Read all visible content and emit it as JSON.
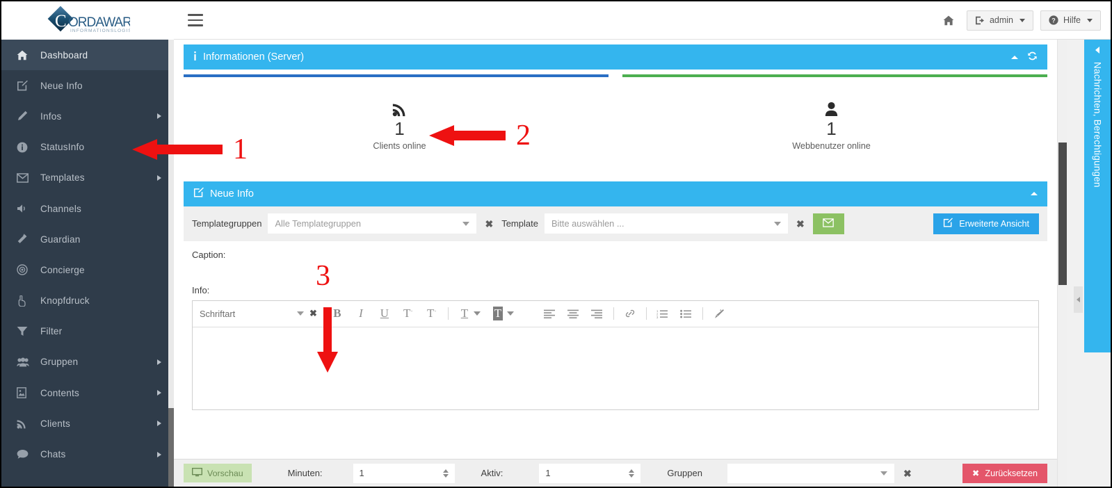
{
  "brand": {
    "name": "CORDAWARE",
    "tagline": "INFORMATIONSLOGISTIK"
  },
  "topbar": {
    "menu_toggle": "hamburger-icon",
    "home_icon": "home-icon",
    "user_button": "admin",
    "help_button": "Hilfe"
  },
  "sidebar": {
    "items": [
      {
        "label": "Dashboard",
        "icon": "home-icon",
        "active": true,
        "submenu": false
      },
      {
        "label": "Neue Info",
        "icon": "edit-square-icon",
        "active": false,
        "submenu": false
      },
      {
        "label": "Infos",
        "icon": "pencil-icon",
        "active": false,
        "submenu": true
      },
      {
        "label": "StatusInfo",
        "icon": "info-circle-icon",
        "active": false,
        "submenu": false
      },
      {
        "label": "Templates",
        "icon": "envelope-icon",
        "active": false,
        "submenu": true
      },
      {
        "label": "Channels",
        "icon": "speaker-icon",
        "active": false,
        "submenu": false
      },
      {
        "label": "Guardian",
        "icon": "magic-wand-icon",
        "active": false,
        "submenu": false
      },
      {
        "label": "Concierge",
        "icon": "bullseye-icon",
        "active": false,
        "submenu": false
      },
      {
        "label": "Knopfdruck",
        "icon": "hand-pointer-icon",
        "active": false,
        "submenu": false
      },
      {
        "label": "Filter",
        "icon": "funnel-icon",
        "active": false,
        "submenu": false
      },
      {
        "label": "Gruppen",
        "icon": "users-icon",
        "active": false,
        "submenu": true
      },
      {
        "label": "Contents",
        "icon": "image-file-icon",
        "active": false,
        "submenu": true
      },
      {
        "label": "Clients",
        "icon": "rss-icon",
        "active": false,
        "submenu": true
      },
      {
        "label": "Chats",
        "icon": "comment-icon",
        "active": false,
        "submenu": true
      }
    ]
  },
  "info_panel": {
    "title": "Informationen (Server)",
    "icon": "info-icon",
    "collapse_icon": "chevron-up-icon",
    "refresh_icon": "refresh-icon",
    "bar_colors": [
      "#2a6fc4",
      "#4caf50"
    ],
    "stats": [
      {
        "value": "1",
        "label": "Clients online",
        "icon": "rss-icon"
      },
      {
        "value": "1",
        "label": "Webbenutzer online",
        "icon": "user-icon"
      }
    ]
  },
  "new_info_panel": {
    "title": "Neue Info",
    "icon": "edit-square-icon",
    "collapse_icon": "chevron-up-icon",
    "form": {
      "templategroups_label": "Templategruppen",
      "templategroups_value": "Alle Templategruppen",
      "template_label": "Template",
      "template_value": "Bitte auswählen ...",
      "mail_button_icon": "envelope-icon",
      "advanced_button": "Erweiterte Ansicht",
      "advanced_button_icon": "edit-square-icon",
      "caption_label": "Caption:",
      "caption_value": "",
      "info_label": "Info:",
      "editor_content": ""
    },
    "editor_toolbar": {
      "font_select": "Schriftart",
      "clear_font_icon": "times-icon",
      "buttons": [
        {
          "name": "bold-icon",
          "glyph": "B"
        },
        {
          "name": "italic-icon",
          "glyph": "I"
        },
        {
          "name": "underline-icon",
          "glyph": "U"
        },
        {
          "name": "superscript-icon",
          "glyph": "T˙"
        },
        {
          "name": "subscript-icon",
          "glyph": "T˙"
        },
        {
          "name": "text-color-icon",
          "glyph": "T"
        },
        {
          "name": "highlight-color-icon",
          "glyph": "T"
        },
        {
          "name": "align-left-icon",
          "glyph": "≡"
        },
        {
          "name": "align-center-icon",
          "glyph": "≡"
        },
        {
          "name": "align-right-icon",
          "glyph": "≡"
        },
        {
          "name": "link-icon",
          "glyph": "⚭"
        },
        {
          "name": "ordered-list-icon",
          "glyph": "≡"
        },
        {
          "name": "unordered-list-icon",
          "glyph": "≡"
        },
        {
          "name": "remove-format-icon",
          "glyph": "✎"
        }
      ]
    }
  },
  "bottom_bar": {
    "preview_button": "Vorschau",
    "preview_icon": "monitor-icon",
    "minutes_label": "Minuten:",
    "minutes_value": "1",
    "active_label": "Aktiv:",
    "active_value": "1",
    "groups_label": "Gruppen",
    "groups_value": "",
    "reset_button": "Zurücksetzen",
    "reset_icon": "times-icon"
  },
  "right_panel": {
    "label": "Nachrichten, Berechtigungen",
    "collapse_icon": "chevron-left-icon",
    "handle_icon": "chevron-left-icon"
  },
  "annotations": [
    {
      "number": "1",
      "target": "sidebar-item-statusinfo"
    },
    {
      "number": "2",
      "target": "stat-clients-online"
    },
    {
      "number": "3",
      "target": "editor-area"
    }
  ],
  "colors": {
    "sidebar_bg": "#2f3c4a",
    "panel_header": "#34b5ee",
    "accent_green": "#8cc163",
    "accent_red": "#e4566a",
    "annotation_red": "#ee1111"
  }
}
